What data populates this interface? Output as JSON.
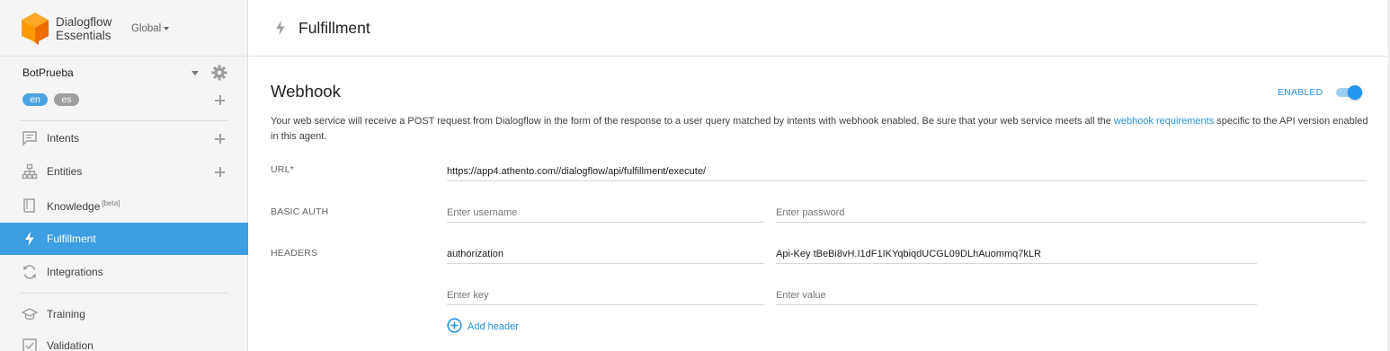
{
  "brand": {
    "name_line1": "Dialogflow",
    "name_line2": "Essentials",
    "region": "Global"
  },
  "agent": {
    "name": "BotPrueba",
    "languages": [
      "en",
      "es"
    ]
  },
  "sidebar": {
    "items": [
      {
        "label": "Intents",
        "icon": "chat-icon"
      },
      {
        "label": "Entities",
        "icon": "hierarchy-icon"
      },
      {
        "label": "Knowledge",
        "badge": "[beta]",
        "icon": "book-icon"
      },
      {
        "label": "Fulfillment",
        "icon": "bolt-icon",
        "active": true
      },
      {
        "label": "Integrations",
        "icon": "refresh-icon"
      },
      {
        "label": "Training",
        "icon": "graduation-cap-icon"
      },
      {
        "label": "Validation",
        "icon": "checkbox-icon"
      }
    ]
  },
  "header": {
    "title": "Fulfillment"
  },
  "webhook": {
    "title": "Webhook",
    "status_label": "ENABLED",
    "enabled": true,
    "description_before": "Your web service will receive a POST request from Dialogflow in the form of the response to a user query matched by intents with webhook enabled. Be sure that your web service meets all the ",
    "description_link": "webhook requirements",
    "description_after": " specific to the API version enabled in this agent.",
    "url_label": "URL*",
    "url_value": "https://app4.athento.com//dialogflow/api/fulfillment/execute/",
    "basic_auth_label": "BASIC AUTH",
    "username_placeholder": "Enter username",
    "password_placeholder": "Enter password",
    "headers_label": "HEADERS",
    "header_key_value": "authorization",
    "header_value_value": "Api-Key tBeBi8vH.I1dF1IKYqbiqdUCGL09DLhAuommq7kLR",
    "key_placeholder": "Enter key",
    "value_placeholder": "Enter value",
    "add_header_label": "Add header"
  },
  "colors": {
    "accent": "#2b8fd8",
    "active_nav": "#3e9ee2",
    "logo": "#f57c00"
  }
}
